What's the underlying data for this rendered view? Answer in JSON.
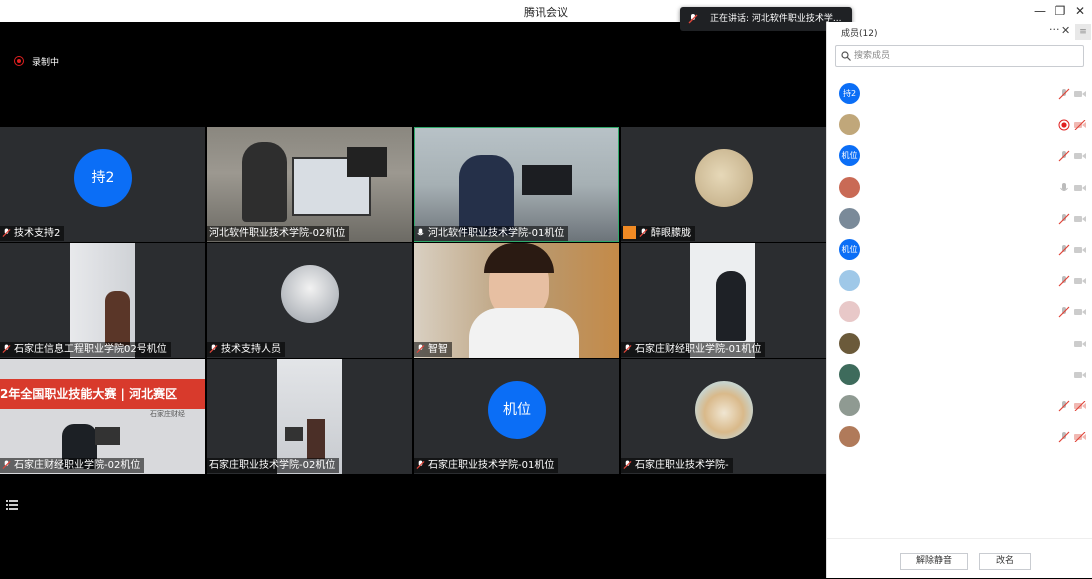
{
  "window": {
    "title": "腾讯会议"
  },
  "speaking": {
    "text": "正在讲话: 河北软件职业技术学..."
  },
  "recording": {
    "label": "录制中"
  },
  "tiles": [
    {
      "name": "技术支持2",
      "avatar_text": "持2"
    },
    {
      "name": "河北软件职业技术学院-02机位"
    },
    {
      "name": "河北软件职业技术学院-01机位"
    },
    {
      "name": "醉眼朦胧"
    },
    {
      "name": "石家庄信息工程职业学院02号机位"
    },
    {
      "name": "技术支持人员"
    },
    {
      "name": "智智"
    },
    {
      "name": "石家庄财经职业学院-01机位"
    },
    {
      "name": "石家庄财经职业学院-02机位",
      "banner": "2年全国职业技能大赛 | 河北赛区",
      "banner_sub": "石家庄财经"
    },
    {
      "name": "石家庄职业技术学院-02机位"
    },
    {
      "name": "石家庄职业技术学院-01机位",
      "avatar_text": "机位"
    },
    {
      "name": "石家庄职业技术学院-"
    }
  ],
  "panel": {
    "title": "成员(12)",
    "search_placeholder": "搜索成员",
    "members": [
      {
        "avatar_text": "持2",
        "color": "#0b6ef6",
        "mic": "muted",
        "cam": "off"
      },
      {
        "avatar_text": "",
        "color": "#c0a77a",
        "mic": "recording",
        "cam": "muted"
      },
      {
        "avatar_text": "机位",
        "color": "#0b6ef6",
        "mic": "muted",
        "cam": "off"
      },
      {
        "avatar_text": "",
        "color": "#c96a55",
        "mic": "on",
        "cam": "off"
      },
      {
        "avatar_text": "",
        "color": "#7a8a99",
        "mic": "muted",
        "cam": "off"
      },
      {
        "avatar_text": "机位",
        "color": "#0b6ef6",
        "mic": "muted",
        "cam": "off"
      },
      {
        "avatar_text": "",
        "color": "#9fc8e8",
        "mic": "muted",
        "cam": "off"
      },
      {
        "avatar_text": "",
        "color": "#e8c8c8",
        "mic": "muted",
        "cam": "off"
      },
      {
        "avatar_text": "",
        "color": "#6b5a3a",
        "mic": "none",
        "cam": "off"
      },
      {
        "avatar_text": "",
        "color": "#3e6b5c",
        "mic": "none",
        "cam": "off"
      },
      {
        "avatar_text": "",
        "color": "#8f9a92",
        "mic": "muted",
        "cam": "muted"
      },
      {
        "avatar_text": "",
        "color": "#b07a5a",
        "mic": "muted",
        "cam": "muted"
      }
    ],
    "unmute_all": "解除静音",
    "rename": "改名"
  },
  "colors": {
    "accent": "#0b6ef6",
    "record": "#e02020",
    "muted": "#e0453a"
  }
}
